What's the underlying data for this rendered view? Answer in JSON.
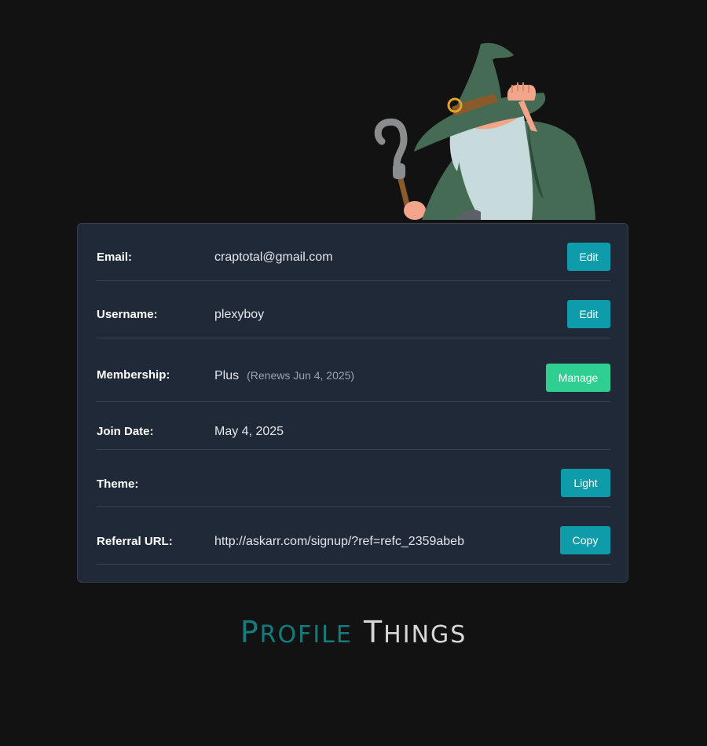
{
  "profile": {
    "email": {
      "label": "Email:",
      "value": "craptotal@gmail.com",
      "button": "Edit"
    },
    "username": {
      "label": "Username:",
      "value": "plexyboy",
      "button": "Edit"
    },
    "membership": {
      "label": "Membership:",
      "value": "Plus",
      "note": "(Renews Jun 4, 2025)",
      "button": "Manage"
    },
    "join_date": {
      "label": "Join Date:",
      "value": "May 4, 2025"
    },
    "theme": {
      "label": "Theme:",
      "button": "Light"
    },
    "referral": {
      "label": "Referral URL:",
      "value": "http://askarr.com/signup/?ref=refc_2359abeb",
      "button": "Copy"
    }
  },
  "footer": {
    "word1_initial": "P",
    "word1_rest": "ROFILE",
    "word2_initial": "T",
    "word2_rest": "HINGS"
  },
  "colors": {
    "background": "#121212",
    "card": "#202938",
    "accent_teal": "#0e9cab",
    "accent_green": "#2fcf91",
    "footer_teal": "#137c7e"
  },
  "icons": {
    "mascot": "wizard-mascot-icon"
  }
}
